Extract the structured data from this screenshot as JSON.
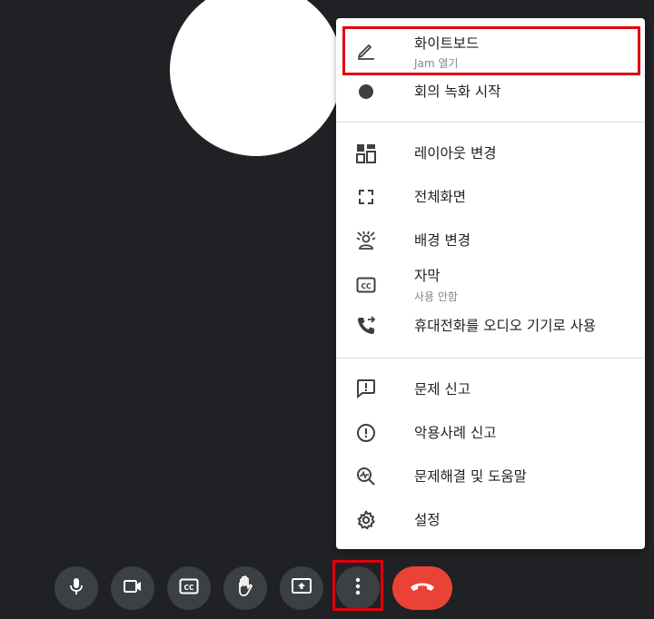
{
  "menu": {
    "items": [
      {
        "label": "화이트보드",
        "sub": "Jam 열기",
        "icon": "pencil-icon"
      },
      {
        "label": "회의 녹화 시작",
        "icon": "record-dot-icon"
      },
      {
        "label": "레이아웃 변경",
        "icon": "layout-icon"
      },
      {
        "label": "전체화면",
        "icon": "fullscreen-icon"
      },
      {
        "label": "배경 변경",
        "icon": "background-person-icon"
      },
      {
        "label": "자막",
        "sub": "사용 안함",
        "icon": "closed-caption-icon"
      },
      {
        "label": "휴대전화를 오디오 기기로 사용",
        "icon": "phone-forward-icon"
      },
      {
        "label": "문제 신고",
        "icon": "feedback-icon"
      },
      {
        "label": "악용사례 신고",
        "icon": "report-icon"
      },
      {
        "label": "문제해결 및 도움말",
        "icon": "troubleshoot-icon"
      },
      {
        "label": "설정",
        "icon": "gear-icon"
      }
    ]
  },
  "controls": [
    {
      "icon": "microphone-icon"
    },
    {
      "icon": "camera-icon"
    },
    {
      "icon": "captions-icon"
    },
    {
      "icon": "raise-hand-icon"
    },
    {
      "icon": "present-screen-icon"
    },
    {
      "icon": "more-options-icon"
    },
    {
      "icon": "end-call-icon"
    }
  ],
  "colors": {
    "background": "#202124",
    "control": "#3c4043",
    "end_call": "#ea4335",
    "highlight": "#e0000f",
    "icon": "#3c4043"
  }
}
